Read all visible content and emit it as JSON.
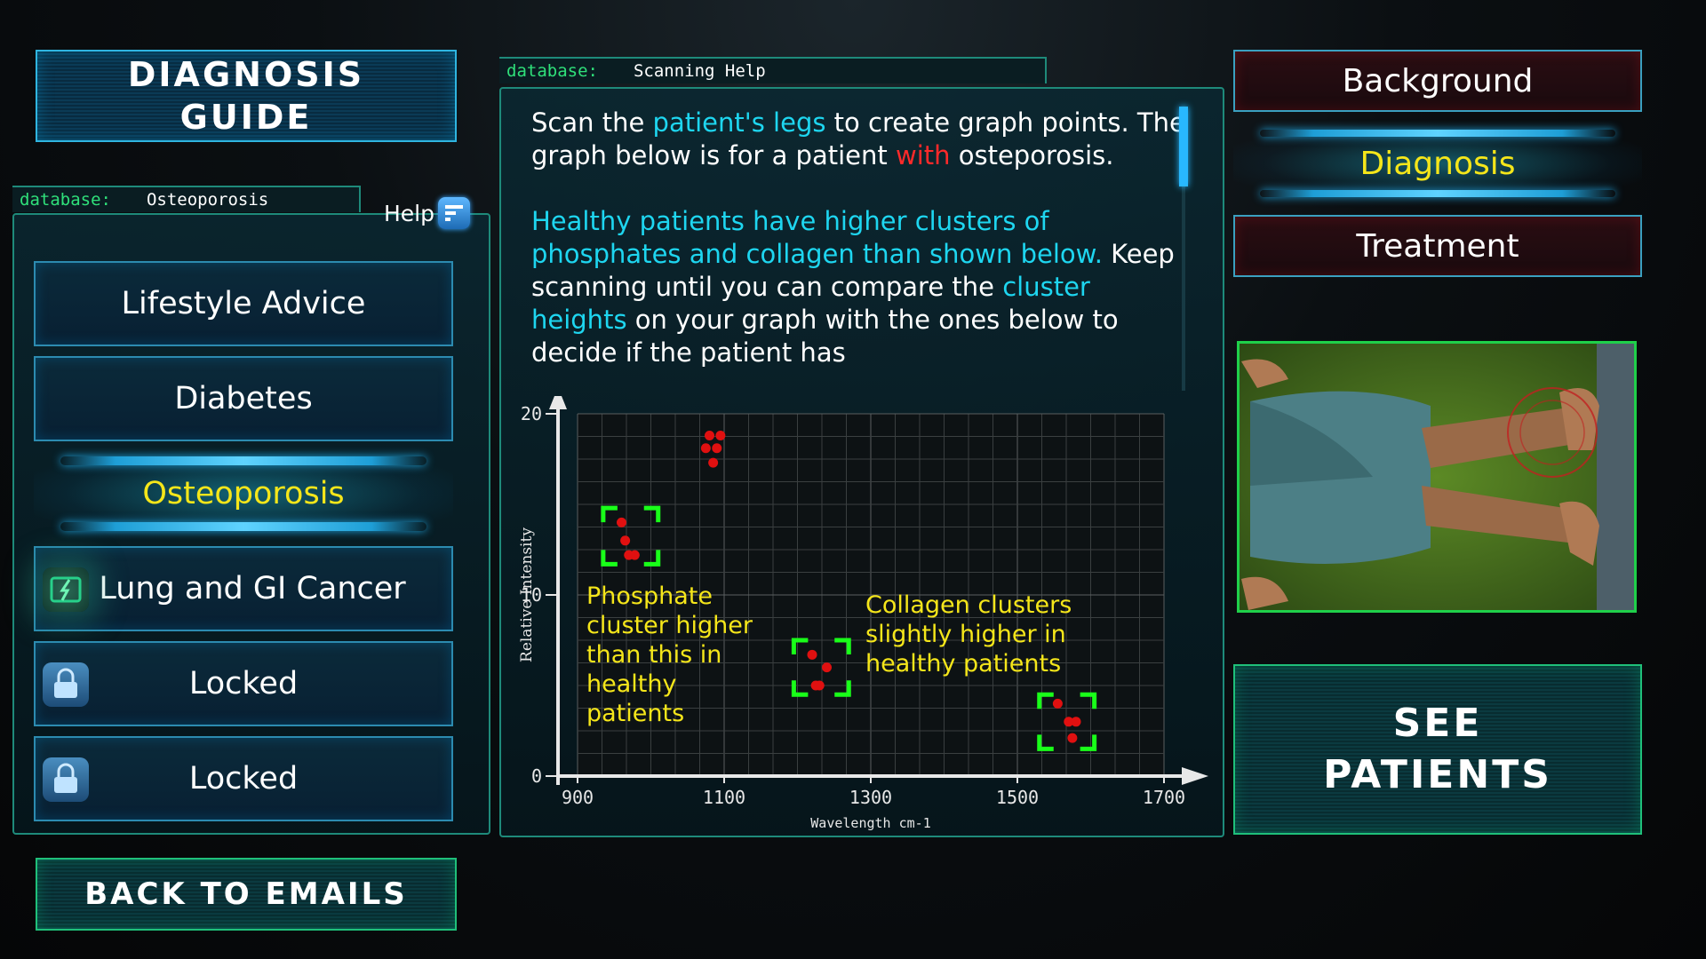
{
  "left": {
    "guide_button": "DIAGNOSIS GUIDE",
    "database_tab": {
      "key": "database:",
      "value": "Osteoporosis"
    },
    "help_label": "Help",
    "items": [
      {
        "label": "Lifestyle Advice",
        "state": "normal"
      },
      {
        "label": "Diabetes",
        "state": "normal"
      },
      {
        "label": "Osteoporosis",
        "state": "selected"
      },
      {
        "label": "Lung and GI Cancer",
        "state": "normal",
        "icon": "battery-icon"
      },
      {
        "label": "Locked",
        "state": "locked",
        "icon": "lock-icon"
      },
      {
        "label": "Locked",
        "state": "locked",
        "icon": "lock-icon"
      }
    ],
    "back_button": "BACK TO EMAILS"
  },
  "center": {
    "database_tab": {
      "key": "database:",
      "value": "Scanning Help"
    },
    "text": {
      "p1a": "Scan the ",
      "p1b": "patient's legs",
      "p1c": " to create graph points. The graph below is for a patient ",
      "p1d": "with",
      "p1e": " osteporosis.",
      "p2a": "Healthy patients have higher clusters of phosphates and collagen than shown below.",
      "p2b": " Keep scanning until you can compare the ",
      "p2c": "cluster heights",
      "p2d": " on your graph with the ones below to decide if the patient has"
    },
    "annotations": {
      "phosphate": "Phosphate cluster higher than this in healthy patients",
      "collagen": "Collagen clusters slightly higher in healthy patients"
    }
  },
  "chart_data": {
    "type": "scatter",
    "xlabel": "Wavelength cm-1",
    "ylabel": "Relative Intensity",
    "xlim": [
      900,
      1700
    ],
    "ylim": [
      0,
      20
    ],
    "xticks": [
      "900",
      "1100",
      "1300",
      "1500",
      "1700"
    ],
    "yticks": [
      "0",
      "10",
      "20"
    ],
    "grid": true,
    "series": [
      {
        "points": [
          [
            1080,
            18.8
          ],
          [
            1095,
            18.8
          ],
          [
            1075,
            18.1
          ],
          [
            1090,
            18.1
          ],
          [
            1085,
            17.3
          ],
          [
            960,
            14.0
          ],
          [
            965,
            13.0
          ],
          [
            970,
            12.2
          ],
          [
            978,
            12.2
          ],
          [
            1220,
            6.7
          ],
          [
            1240,
            6.0
          ],
          [
            1225,
            5.0
          ],
          [
            1230,
            5.0
          ],
          [
            1555,
            4.0
          ],
          [
            1570,
            3.0
          ],
          [
            1580,
            3.0
          ],
          [
            1575,
            2.1
          ]
        ]
      }
    ],
    "highlight_boxes": [
      {
        "x": [
          935,
          1010
        ],
        "y": [
          11.7,
          14.8
        ]
      },
      {
        "x": [
          1195,
          1270
        ],
        "y": [
          4.5,
          7.5
        ]
      },
      {
        "x": [
          1530,
          1605
        ],
        "y": [
          1.5,
          4.5
        ]
      }
    ],
    "colors": {
      "points": "#e01010",
      "boxes": "#19ff19"
    }
  },
  "right": {
    "tabs": [
      {
        "label": "Background",
        "state": "normal"
      },
      {
        "label": "Diagnosis",
        "state": "selected"
      },
      {
        "label": "Treatment",
        "state": "normal"
      }
    ],
    "see_patients": "SEE PATIENTS"
  }
}
